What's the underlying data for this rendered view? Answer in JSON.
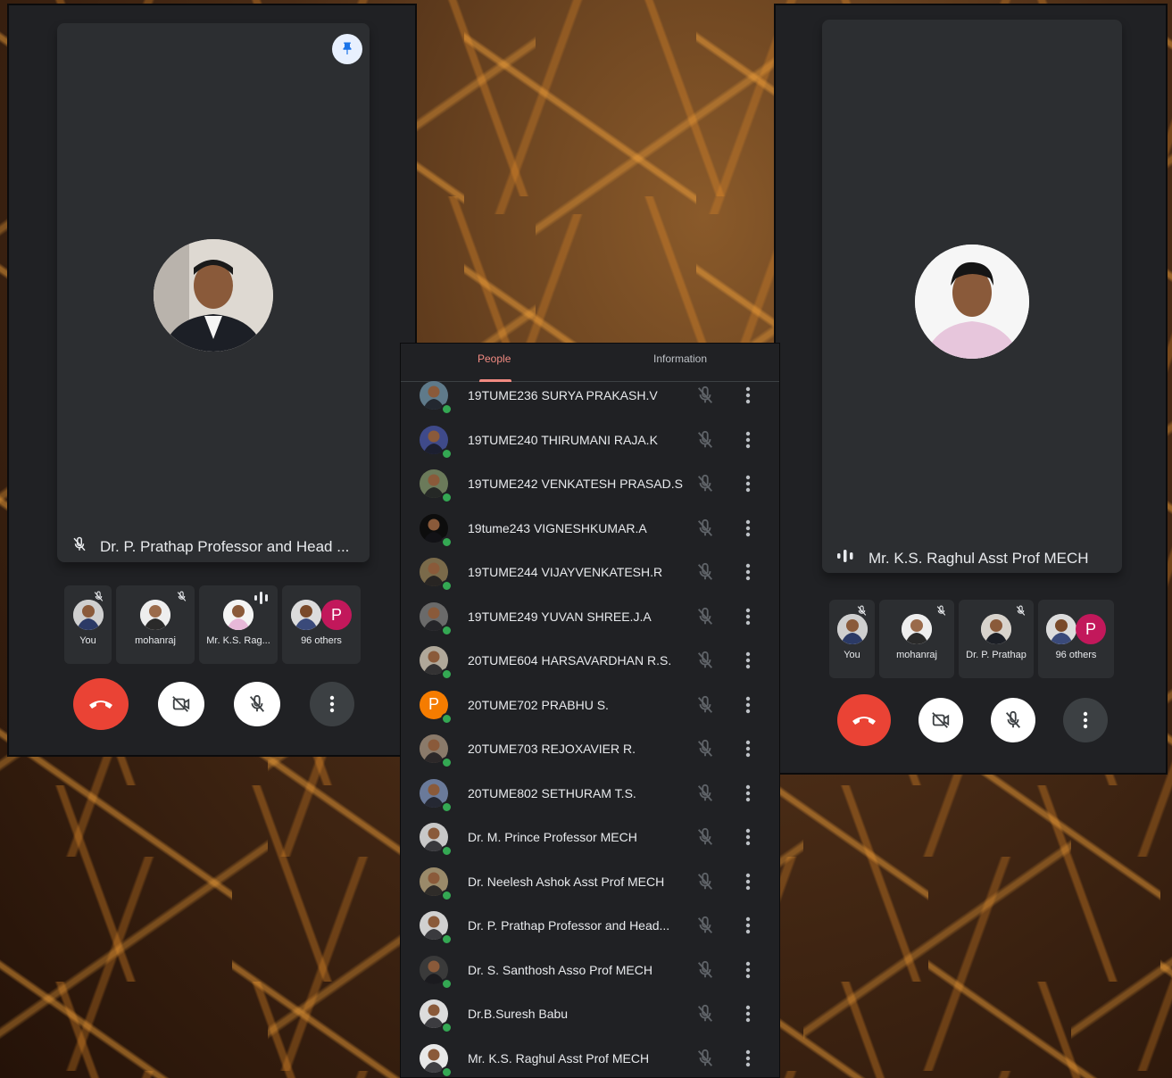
{
  "left_call": {
    "stage_name": "Dr. P. Prathap Professor and Head ...",
    "tiles": [
      {
        "label": "You",
        "muted": true
      },
      {
        "label": "mohanraj",
        "muted": true
      },
      {
        "label": "Mr. K.S. Rag...",
        "speaking": true
      },
      {
        "label": "96 others",
        "badge": "P"
      }
    ]
  },
  "right_call": {
    "stage_name": "Mr. K.S. Raghul Asst Prof MECH",
    "tiles": [
      {
        "label": "You",
        "muted": true
      },
      {
        "label": "mohanraj",
        "muted": true
      },
      {
        "label": "Dr. P. Prathap",
        "muted": true
      },
      {
        "label": "96 others",
        "badge": "P"
      }
    ]
  },
  "people_panel": {
    "tabs": {
      "people": "People",
      "information": "Information"
    },
    "participants": [
      {
        "name": "19TUME236 SURYA PRAKASH.V",
        "avatar_color": "#5f7a8a"
      },
      {
        "name": "19TUME240 THIRUMANI RAJA.K",
        "avatar_color": "#3f4a8a"
      },
      {
        "name": "19TUME242 VENKATESH PRASAD.S",
        "avatar_color": "#6b7a5a"
      },
      {
        "name": "19tume243 VIGNESHKUMAR.A",
        "avatar_color": "#0d0d0d"
      },
      {
        "name": "19TUME244 VIJAYVENKATESH.R",
        "avatar_color": "#7a6a4a"
      },
      {
        "name": "19TUME249 YUVAN SHREE.J.A",
        "avatar_color": "#6a6a6a"
      },
      {
        "name": "20TUME604 HARSAVARDHAN R.S.",
        "avatar_color": "#b0a89a"
      },
      {
        "name": "20TUME702 PRABHU S.",
        "avatar_letter": "P",
        "avatar_color": "#f57c00"
      },
      {
        "name": "20TUME703 REJOXAVIER R.",
        "avatar_color": "#8a7a6a"
      },
      {
        "name": "20TUME802 SETHURAM T.S.",
        "avatar_color": "#6a7a9a"
      },
      {
        "name": "Dr. M. Prince Professor MECH",
        "avatar_color": "#c8c8c8"
      },
      {
        "name": "Dr. Neelesh Ashok Asst Prof MECH",
        "avatar_color": "#9a8a6a"
      },
      {
        "name": "Dr. P. Prathap Professor and Head...",
        "avatar_color": "#d0d0d0"
      },
      {
        "name": "Dr. S. Santhosh Asso Prof MECH",
        "avatar_color": "#3a3a3a"
      },
      {
        "name": "Dr.B.Suresh Babu",
        "avatar_color": "#dcdcdc"
      },
      {
        "name": "Mr. K.S. Raghul Asst Prof MECH",
        "avatar_color": "#e8e8e8"
      }
    ]
  },
  "colors": {
    "end_call": "#ea4335",
    "accent_tab": "#f28b82",
    "online_dot": "#34a853",
    "badge": "#c2185b"
  }
}
